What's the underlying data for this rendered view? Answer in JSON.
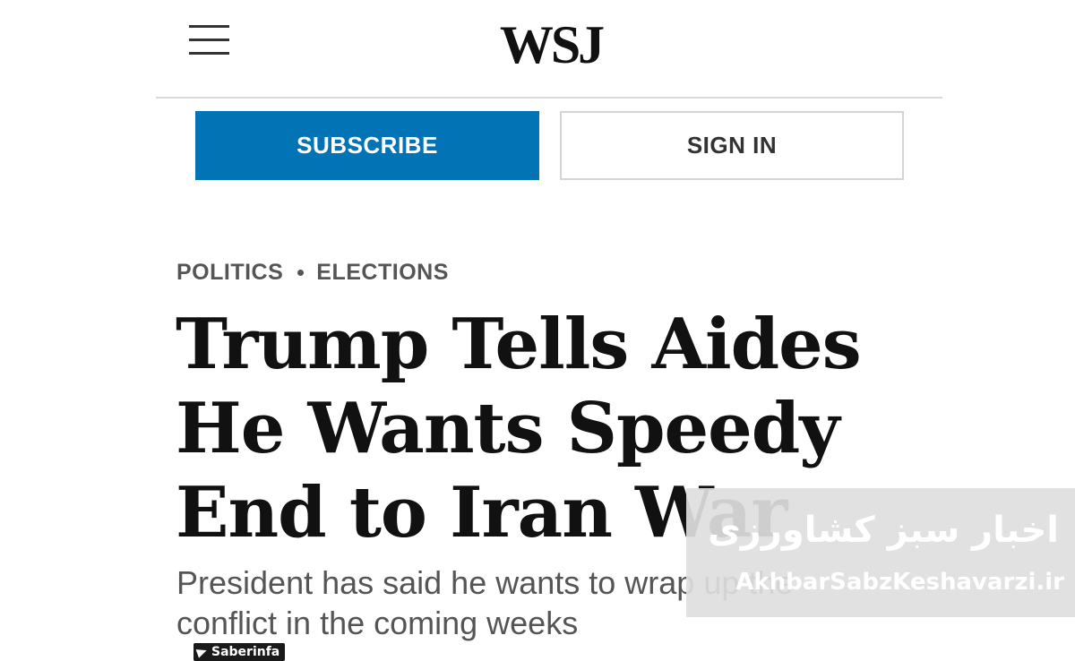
{
  "header": {
    "logo_text": "WSJ",
    "menu_icon": "hamburger-menu-icon"
  },
  "actions": {
    "subscribe_label": "SUBSCRIBE",
    "signin_label": "SIGN IN",
    "subscribe_color": "#0274b6"
  },
  "article": {
    "breadcrumb": [
      "POLITICS",
      "ELECTIONS"
    ],
    "headline_lines": [
      "Trump Tells Aides",
      "He Wants Speedy",
      "End to Iran War"
    ],
    "dek_lines": [
      "President has said he wants to wrap up the",
      "conflict in the coming weeks"
    ]
  },
  "watermark": {
    "title": "اخبار سبز کشاورزی",
    "url": "AkhbarSabzKeshavarzi.ir"
  },
  "channel_tag": {
    "icon": "telegram-icon",
    "label": "Saberinfa"
  }
}
